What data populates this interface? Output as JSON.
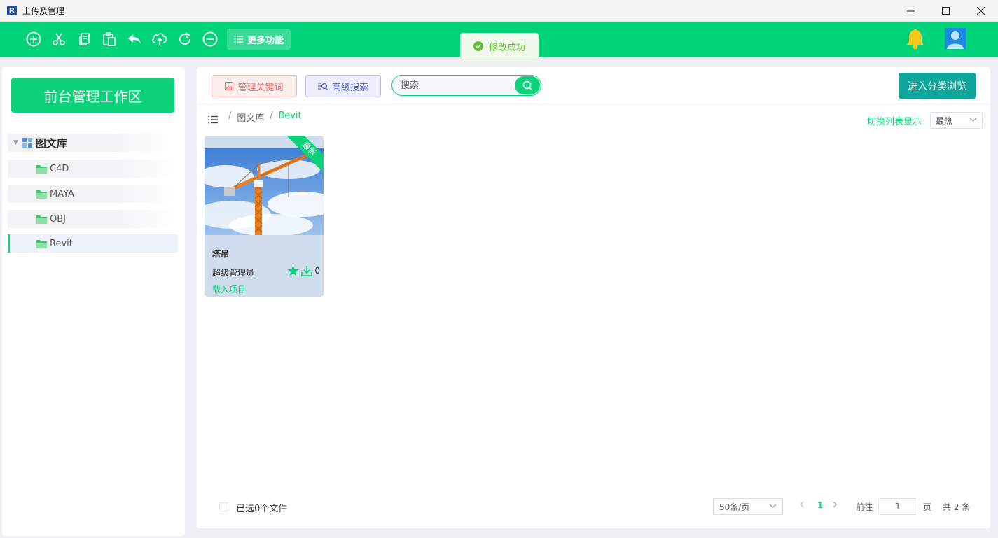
{
  "window": {
    "app_icon_letter": "R",
    "title": "上传及管理",
    "minimize": "—",
    "maximize": "☐",
    "close": "✕"
  },
  "toolbar": {
    "icons": [
      "add-icon",
      "cut-icon",
      "copy-icon",
      "paste-icon",
      "undo-icon",
      "upload-icon",
      "redo-icon",
      "remove-icon"
    ],
    "more_label": "更多功能",
    "accent": "#00d27a"
  },
  "toast": {
    "message": "修改成功"
  },
  "sidebar": {
    "workspace_label": "前台管理工作区",
    "tree_root": "图文库",
    "items": [
      {
        "label": "C4D"
      },
      {
        "label": "MAYA"
      },
      {
        "label": "OBJ"
      },
      {
        "label": "Revit"
      }
    ]
  },
  "main": {
    "keyword_btn": "管理关键词",
    "advanced_btn": "高级搜索",
    "search_placeholder": "搜索",
    "category_btn": "进入分类浏览",
    "breadcrumb": [
      "图文库",
      "Revit"
    ],
    "switch_view": "切换列表显示",
    "sort_value": "最热"
  },
  "card": {
    "ribbon": "最新",
    "title": "塔吊",
    "author": "超级管理员",
    "downloads": "0",
    "action": "载入项目"
  },
  "footer": {
    "selected_text": "已选0个文件",
    "page_size": "50条/页",
    "current_page": "1",
    "goto_label": "前往",
    "goto_value": "1",
    "page_unit": "页",
    "total": "共 2 条"
  }
}
